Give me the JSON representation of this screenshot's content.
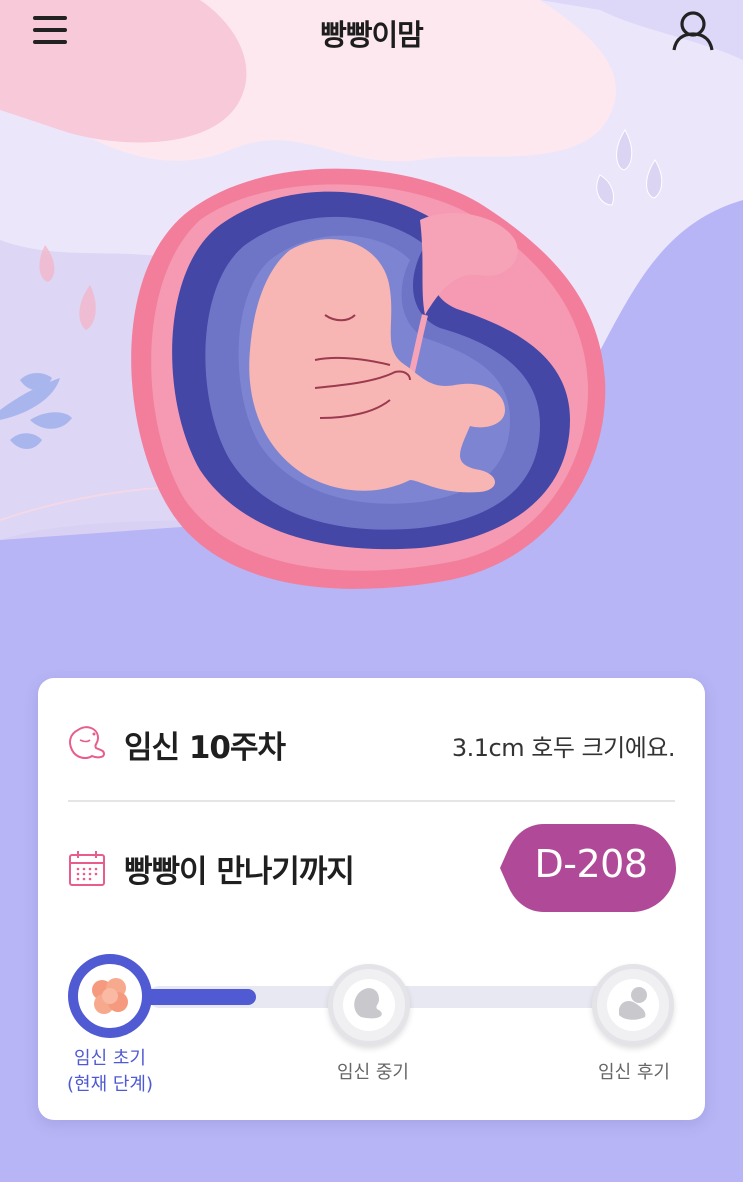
{
  "app": {
    "title": "빵빵이맘"
  },
  "header": {
    "menu_icon": "hamburger-menu-icon",
    "user_icon": "user-icon"
  },
  "colors": {
    "accent_blue": "#4f5ad3",
    "dday_badge": "#b04a98",
    "background": "#b7b5f5",
    "pink": "#f4819f"
  },
  "week_info": {
    "icon": "embryo-icon",
    "label": "임신 10주차",
    "size_text": "3.1cm 호두 크기에요."
  },
  "countdown": {
    "icon": "calendar-icon",
    "label": "빵빵이 만나기까지",
    "dday": "D-208"
  },
  "progress": {
    "stages": [
      {
        "label_line1": "임신 초기",
        "label_line2": "(현재 단계)",
        "icon": "cell-cluster-icon",
        "active": true
      },
      {
        "label_line1": "임신 중기",
        "icon": "embryo-stage-icon",
        "active": false
      },
      {
        "label_line1": "임신 후기",
        "icon": "baby-stage-icon",
        "active": false
      }
    ]
  }
}
